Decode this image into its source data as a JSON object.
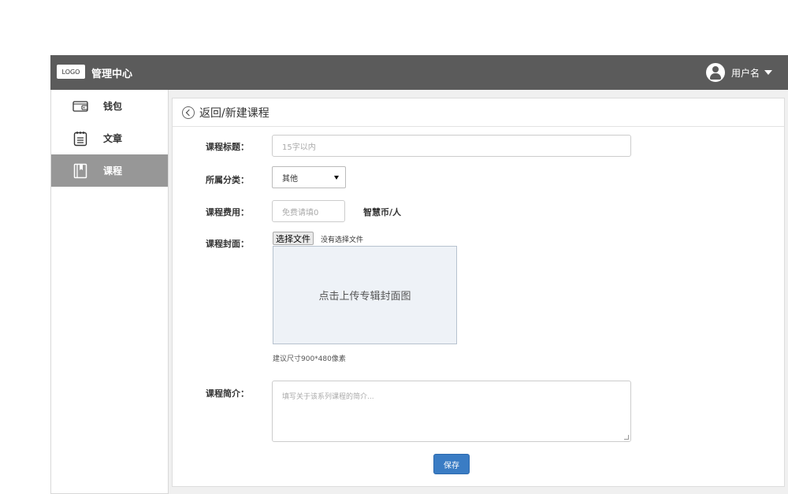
{
  "header": {
    "logo_text": "LOGO",
    "brand": "管理中心",
    "username": "用户名"
  },
  "sidebar": {
    "items": [
      {
        "label": "钱包",
        "icon": "wallet-icon",
        "active": false
      },
      {
        "label": "文章",
        "icon": "notepad-icon",
        "active": false
      },
      {
        "label": "课程",
        "icon": "book-icon",
        "active": true
      }
    ]
  },
  "main": {
    "title": "返回/新建课程",
    "form": {
      "title_label": "课程标题：",
      "title_placeholder": "15字以内",
      "category_label": "所属分类：",
      "category_value": "其他",
      "fee_label": "课程费用：",
      "fee_placeholder": "免费请填0",
      "fee_unit": "智慧币/人",
      "cover_label": "课程封面：",
      "file_button": "选择文件",
      "file_status": "没有选择文件",
      "upload_text": "点击上传专辑封面图",
      "size_hint": "建议尺寸900*480像素",
      "intro_label": "课程简介：",
      "intro_placeholder": "填写关于该系列课程的简介...",
      "save_button": "保存"
    }
  },
  "colors": {
    "topbar": "#5b5b5b",
    "sidebar_active": "#979797",
    "primary_button": "#3a7cc4"
  }
}
